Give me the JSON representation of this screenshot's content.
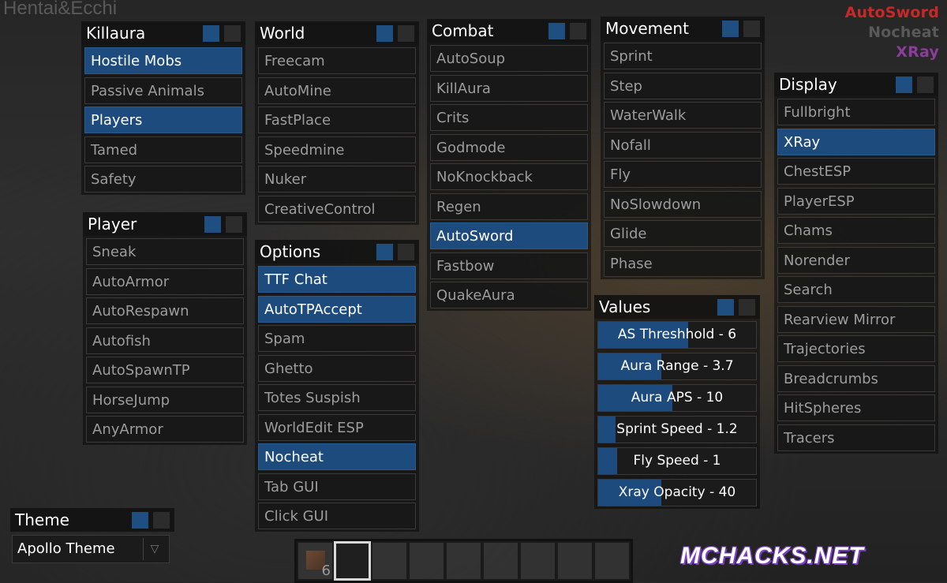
{
  "watermark": "Hentai&Ecchi",
  "active_mods": [
    {
      "label": "AutoSword",
      "color": "#c82828"
    },
    {
      "label": "Nocheat",
      "color": "#595959"
    },
    {
      "label": "XRay",
      "color": "#8c3c9c"
    }
  ],
  "panels": {
    "killaura": {
      "title": "Killaura",
      "items": [
        {
          "label": "Hostile Mobs",
          "on": true
        },
        {
          "label": "Passive Animals",
          "on": false
        },
        {
          "label": "Players",
          "on": true
        },
        {
          "label": "Tamed",
          "on": false
        },
        {
          "label": "Safety",
          "on": false
        }
      ]
    },
    "player": {
      "title": "Player",
      "items": [
        {
          "label": "Sneak",
          "on": false
        },
        {
          "label": "AutoArmor",
          "on": false
        },
        {
          "label": "AutoRespawn",
          "on": false
        },
        {
          "label": "Autofish",
          "on": false
        },
        {
          "label": "AutoSpawnTP",
          "on": false
        },
        {
          "label": "HorseJump",
          "on": false
        },
        {
          "label": "AnyArmor",
          "on": false
        }
      ]
    },
    "world": {
      "title": "World",
      "items": [
        {
          "label": "Freecam",
          "on": false
        },
        {
          "label": "AutoMine",
          "on": false
        },
        {
          "label": "FastPlace",
          "on": false
        },
        {
          "label": "Speedmine",
          "on": false
        },
        {
          "label": "Nuker",
          "on": false
        },
        {
          "label": "CreativeControl",
          "on": false
        }
      ]
    },
    "options": {
      "title": "Options",
      "items": [
        {
          "label": "TTF Chat",
          "on": true
        },
        {
          "label": "AutoTPAccept",
          "on": true
        },
        {
          "label": "Spam",
          "on": false
        },
        {
          "label": "Ghetto",
          "on": false
        },
        {
          "label": "Totes Suspish",
          "on": false
        },
        {
          "label": "WorldEdit ESP",
          "on": false
        },
        {
          "label": "Nocheat",
          "on": true
        },
        {
          "label": "Tab GUI",
          "on": false
        },
        {
          "label": "Click GUI",
          "on": false
        }
      ]
    },
    "combat": {
      "title": "Combat",
      "items": [
        {
          "label": "AutoSoup",
          "on": false
        },
        {
          "label": "KillAura",
          "on": false
        },
        {
          "label": "Crits",
          "on": false
        },
        {
          "label": "Godmode",
          "on": false
        },
        {
          "label": "NoKnockback",
          "on": false
        },
        {
          "label": "Regen",
          "on": false
        },
        {
          "label": "AutoSword",
          "on": true
        },
        {
          "label": "Fastbow",
          "on": false
        },
        {
          "label": "QuakeAura",
          "on": false
        }
      ]
    },
    "movement": {
      "title": "Movement",
      "items": [
        {
          "label": "Sprint",
          "on": false
        },
        {
          "label": "Step",
          "on": false
        },
        {
          "label": "WaterWalk",
          "on": false
        },
        {
          "label": "Nofall",
          "on": false
        },
        {
          "label": "Fly",
          "on": false
        },
        {
          "label": "NoSlowdown",
          "on": false
        },
        {
          "label": "Glide",
          "on": false
        },
        {
          "label": "Phase",
          "on": false
        }
      ]
    },
    "display": {
      "title": "Display",
      "items": [
        {
          "label": "Fullbright",
          "on": false
        },
        {
          "label": "XRay",
          "on": true
        },
        {
          "label": "ChestESP",
          "on": false
        },
        {
          "label": "PlayerESP",
          "on": false
        },
        {
          "label": "Chams",
          "on": false
        },
        {
          "label": "Norender",
          "on": false
        },
        {
          "label": "Search",
          "on": false
        },
        {
          "label": "Rearview Mirror",
          "on": false
        },
        {
          "label": "Trajectories",
          "on": false
        },
        {
          "label": "Breadcrumbs",
          "on": false
        },
        {
          "label": "HitSpheres",
          "on": false
        },
        {
          "label": "Tracers",
          "on": false
        }
      ]
    }
  },
  "values": {
    "title": "Values",
    "sliders": [
      {
        "label": "AS Threshhold - 6",
        "fraction": 0.57
      },
      {
        "label": "Aura Range - 3.7",
        "fraction": 0.4
      },
      {
        "label": "Aura APS - 10",
        "fraction": 0.47
      },
      {
        "label": "Sprint Speed - 1.2",
        "fraction": 0.11
      },
      {
        "label": "Fly Speed - 1",
        "fraction": 0.12
      },
      {
        "label": "Xray Opacity - 40",
        "fraction": 0.4
      }
    ]
  },
  "theme": {
    "title": "Theme",
    "selected": "Apollo Theme",
    "arrow_icon": "▽"
  },
  "hotbar": {
    "slots": 9,
    "selected": 1,
    "first_count": "6"
  },
  "logo": "MCHACKS.NET",
  "colors": {
    "accent": "#1d4b7d",
    "item_bg": "#181818",
    "item_text": "#9c9c9c"
  }
}
